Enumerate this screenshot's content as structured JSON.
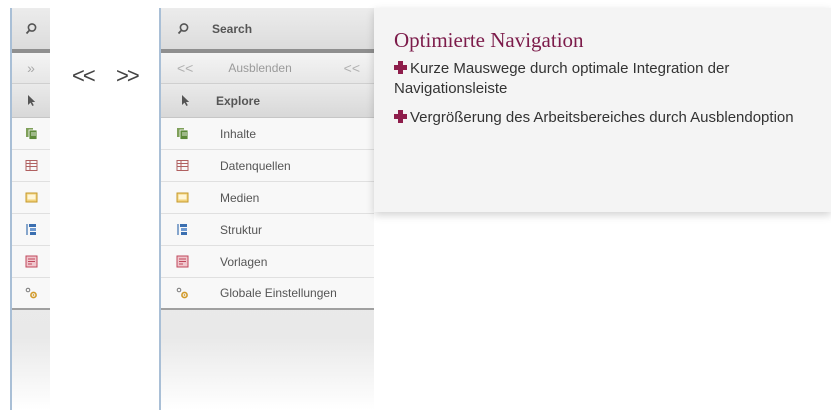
{
  "collapsed_nav": {
    "toggle_label": "»",
    "items": [
      {
        "icon": "inhalte-icon"
      },
      {
        "icon": "datenquellen-icon"
      },
      {
        "icon": "medien-icon"
      },
      {
        "icon": "struktur-icon"
      },
      {
        "icon": "vorlagen-icon"
      },
      {
        "icon": "einstellungen-icon"
      }
    ]
  },
  "arrows": {
    "collapse": "<<",
    "expand": ">>"
  },
  "nav": {
    "search_label": "Search",
    "toggle_left": "<<",
    "toggle_label": "Ausblenden",
    "toggle_right": "<<",
    "explore_label": "Explore",
    "items": [
      {
        "label": "Inhalte",
        "icon": "inhalte-icon"
      },
      {
        "label": "Datenquellen",
        "icon": "datenquellen-icon"
      },
      {
        "label": "Medien",
        "icon": "medien-icon"
      },
      {
        "label": "Struktur",
        "icon": "struktur-icon"
      },
      {
        "label": "Vorlagen",
        "icon": "vorlagen-icon"
      },
      {
        "label": "Globale Einstellungen",
        "icon": "einstellungen-icon"
      }
    ]
  },
  "info": {
    "title": "Optimierte Navigation",
    "bullets": [
      "Kurze Mauswege durch optimale Integration der Navigationsleiste",
      "Vergrößerung des Arbeitsbereiches durch Ausblendoption"
    ]
  },
  "colors": {
    "accent": "#7c1b4a",
    "plus": "#8e1d4b",
    "nav_border": "#a9bfd6"
  }
}
